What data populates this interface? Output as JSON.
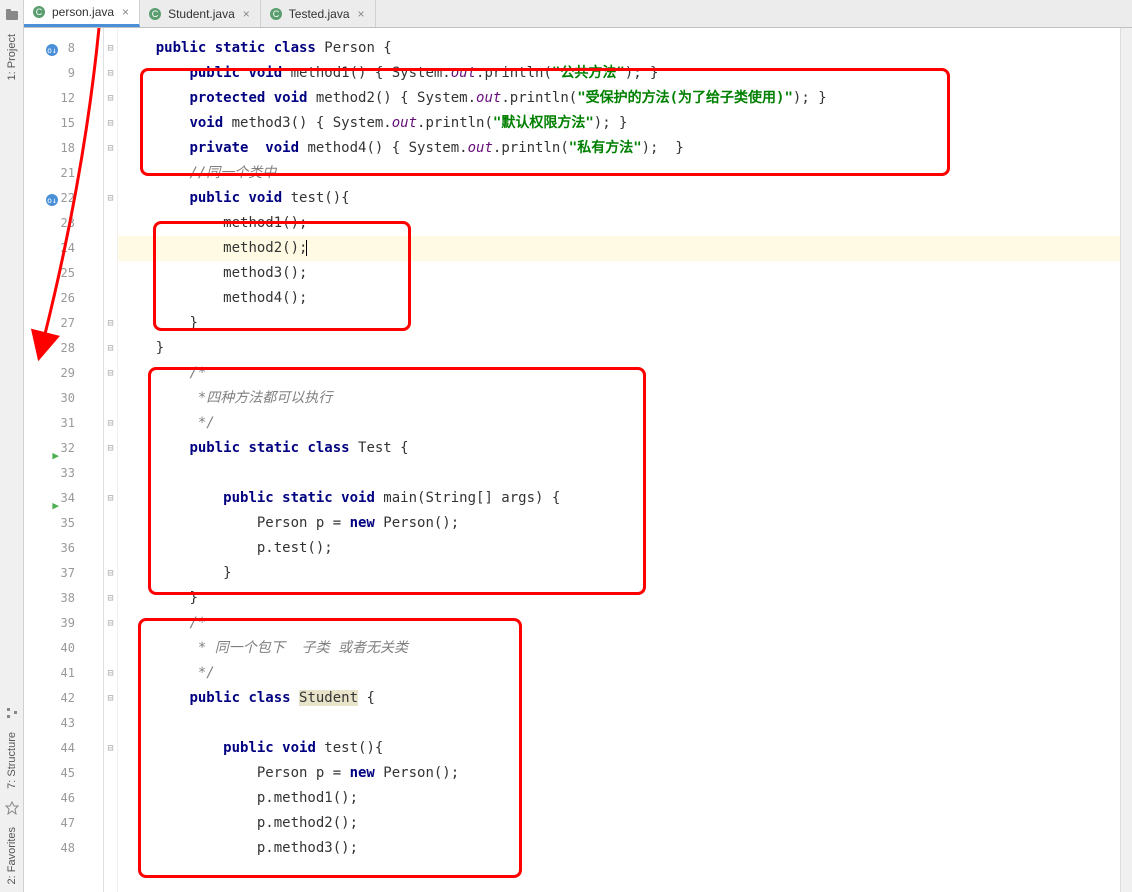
{
  "leftTools": {
    "project": "1: Project",
    "structure": "7: Structure",
    "favorites": "2: Favorites"
  },
  "tabs": [
    {
      "label": "person.java",
      "active": true
    },
    {
      "label": "Student.java",
      "active": false
    },
    {
      "label": "Tested.java",
      "active": false
    }
  ],
  "lines": [
    {
      "num": "8",
      "icon": "override"
    },
    {
      "num": "9",
      "icon": ""
    },
    {
      "num": "12",
      "icon": ""
    },
    {
      "num": "15",
      "icon": ""
    },
    {
      "num": "18",
      "icon": ""
    },
    {
      "num": "21",
      "icon": ""
    },
    {
      "num": "22",
      "icon": "override"
    },
    {
      "num": "23",
      "icon": ""
    },
    {
      "num": "24",
      "icon": ""
    },
    {
      "num": "25",
      "icon": ""
    },
    {
      "num": "26",
      "icon": ""
    },
    {
      "num": "27",
      "icon": ""
    },
    {
      "num": "28",
      "icon": ""
    },
    {
      "num": "29",
      "icon": ""
    },
    {
      "num": "30",
      "icon": ""
    },
    {
      "num": "31",
      "icon": ""
    },
    {
      "num": "32",
      "icon": "run"
    },
    {
      "num": "33",
      "icon": ""
    },
    {
      "num": "34",
      "icon": "run"
    },
    {
      "num": "35",
      "icon": ""
    },
    {
      "num": "36",
      "icon": ""
    },
    {
      "num": "37",
      "icon": ""
    },
    {
      "num": "38",
      "icon": ""
    },
    {
      "num": "39",
      "icon": ""
    },
    {
      "num": "40",
      "icon": ""
    },
    {
      "num": "41",
      "icon": ""
    },
    {
      "num": "42",
      "icon": ""
    },
    {
      "num": "43",
      "icon": ""
    },
    {
      "num": "44",
      "icon": ""
    },
    {
      "num": "45",
      "icon": ""
    },
    {
      "num": "46",
      "icon": ""
    },
    {
      "num": "47",
      "icon": ""
    },
    {
      "num": "48",
      "icon": ""
    }
  ],
  "code": {
    "l8": {
      "indent": "    ",
      "kw1": "public static class",
      "name": " Person {"
    },
    "l9": {
      "indent": "        ",
      "kw1": "public void",
      "mth": " method1() { ",
      "sys": "System.",
      "out": "out",
      "pr": ".println(",
      "str": "\"公共方法\"",
      "end": "); }"
    },
    "l12": {
      "indent": "        ",
      "kw1": "protected void",
      "mth": " method2() { ",
      "sys": "System.",
      "out": "out",
      "pr": ".println(",
      "str": "\"受保护的方法(为了给子类使用)\"",
      "end": "); }"
    },
    "l15": {
      "indent": "        ",
      "kw1": "void",
      "mth": " method3() { ",
      "sys": "System.",
      "out": "out",
      "pr": ".println(",
      "str": "\"默认权限方法\"",
      "end": "); }"
    },
    "l18": {
      "indent": "        ",
      "kw1": "private  void",
      "mth": " method4() { ",
      "sys": "System.",
      "out": "out",
      "pr": ".println(",
      "str": "\"私有方法\"",
      "end": ");  }"
    },
    "l21": {
      "indent": "        ",
      "cmt": "//同一个类中"
    },
    "l22": {
      "indent": "        ",
      "kw1": "public void",
      "mth": " test(){"
    },
    "l23": {
      "indent": "            ",
      "txt": "method1();"
    },
    "l24": {
      "indent": "            ",
      "txt": "method2();"
    },
    "l25": {
      "indent": "            ",
      "txt": "method3();"
    },
    "l26": {
      "indent": "            ",
      "txt": "method4();"
    },
    "l27": {
      "indent": "        ",
      "txt": "}"
    },
    "l28": {
      "indent": "    ",
      "txt": "}"
    },
    "l29": {
      "indent": "        ",
      "cmt": "/*"
    },
    "l30": {
      "indent": "         ",
      "cmt": "*四种方法都可以执行"
    },
    "l31": {
      "indent": "         ",
      "cmt": "*/"
    },
    "l32": {
      "indent": "        ",
      "kw1": "public static class",
      "name": " Test {"
    },
    "l33": {
      "indent": "",
      "txt": ""
    },
    "l34": {
      "indent": "            ",
      "kw1": "public static void",
      "mth": " main(String[] args) {"
    },
    "l35": {
      "indent": "                ",
      "txt1": "Person p = ",
      "kw": "new",
      "txt2": " Person();"
    },
    "l36": {
      "indent": "                ",
      "txt": "p.test();"
    },
    "l37": {
      "indent": "            ",
      "txt": "}"
    },
    "l38": {
      "indent": "        ",
      "txt": "}"
    },
    "l39": {
      "indent": "        ",
      "cmt": "/*"
    },
    "l40": {
      "indent": "         ",
      "cmt": "* 同一个包下  子类 或者无关类"
    },
    "l41": {
      "indent": "         ",
      "cmt": "*/"
    },
    "l42": {
      "indent": "        ",
      "kw1": "public class ",
      "hlname": "Student",
      "name": " {"
    },
    "l43": {
      "indent": "",
      "txt": ""
    },
    "l44": {
      "indent": "            ",
      "kw1": "public void",
      "mth": " test(){"
    },
    "l45": {
      "indent": "                ",
      "txt1": "Person p = ",
      "kw": "new",
      "txt2": " Person();"
    },
    "l46": {
      "indent": "                ",
      "txt": "p.method1();"
    },
    "l47": {
      "indent": "                ",
      "txt": "p.method2();"
    },
    "l48": {
      "indent": "                ",
      "txt": "p.method3();"
    }
  }
}
